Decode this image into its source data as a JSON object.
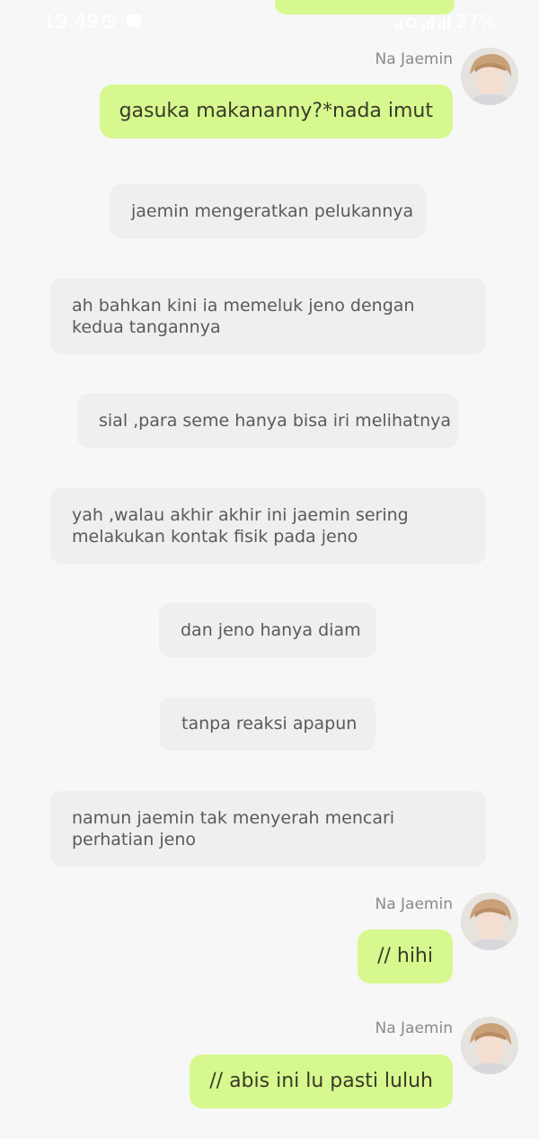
{
  "status_bar": {
    "time": "19.49",
    "battery": "27%"
  },
  "messages": [
    {
      "type": "user",
      "sender": "Na Jaemin",
      "text": "gasuka makananny?*nada imut"
    },
    {
      "type": "narration",
      "text": "jaemin mengeratkan pelukannya"
    },
    {
      "type": "narration",
      "text": "ah bahkan kini ia memeluk jeno dengan kedua tangannya"
    },
    {
      "type": "narration",
      "text": "sial ,para seme hanya bisa iri melihatnya"
    },
    {
      "type": "narration",
      "text": "yah ,walau akhir akhir ini jaemin sering melakukan kontak fisik pada jeno"
    },
    {
      "type": "narration",
      "text": "dan jeno hanya diam"
    },
    {
      "type": "narration",
      "text": "tanpa reaksi apapun"
    },
    {
      "type": "narration",
      "text": "namun jaemin tak menyerah mencari perhatian jeno"
    },
    {
      "type": "user",
      "sender": "Na Jaemin",
      "text": "// hihi"
    },
    {
      "type": "user",
      "sender": "Na Jaemin",
      "text": "// abis ini lu pasti luluh"
    }
  ],
  "colors": {
    "background": "#f7f7f7",
    "user_bubble": "#d7f88e",
    "narration_bubble": "#efefef",
    "sender_name": "#8a8a8a"
  }
}
